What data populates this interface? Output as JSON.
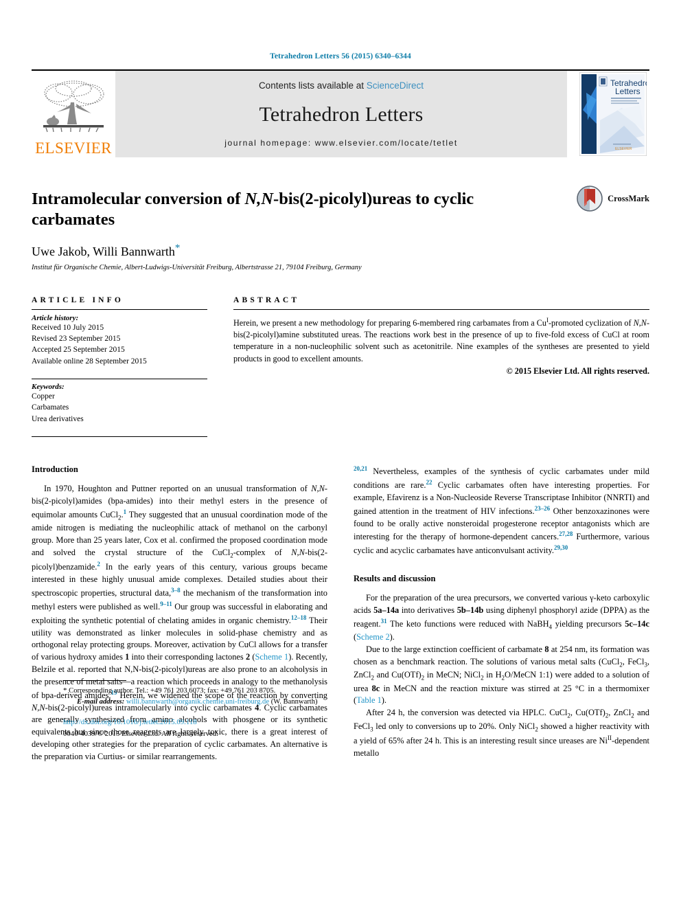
{
  "running_head": "Tetrahedron Letters 56 (2015) 6340–6344",
  "masthead": {
    "contents_prefix": "Contents lists available at ",
    "sciencedirect": "ScienceDirect",
    "journal_name": "Tetrahedron Letters",
    "homepage": "journal homepage: www.elsevier.com/locate/tetlet",
    "publisher_wordmark": "ELSEVIER",
    "cover_title_line1": "Tetrahedron",
    "cover_title_line2": "Letters",
    "colors": {
      "link": "#3c8fbf",
      "elsevier_orange": "#f07f09",
      "running_head": "#0c7ca8",
      "masthead_bg": "#e4e4e4"
    }
  },
  "title": {
    "part1": "Intramolecular conversion of ",
    "italic": "N,N",
    "part2": "-bis(2-picolyl)ureas to cyclic carbamates"
  },
  "authors": "Uwe Jakob, Willi Bannwarth",
  "corresponding_star": "*",
  "affiliation": "Institut für Organische Chemie, Albert-Ludwigs-Universität Freiburg, Albertstrasse 21, 79104 Freiburg, Germany",
  "crossmark_label": "CrossMark",
  "article_info": {
    "heading": "ARTICLE INFO",
    "history_label": "Article history:",
    "history": [
      "Received 10 July 2015",
      "Revised 23 September 2015",
      "Accepted 25 September 2015",
      "Available online 28 September 2015"
    ],
    "keywords_label": "Keywords:",
    "keywords": [
      "Copper",
      "Carbamates",
      "Urea derivatives"
    ]
  },
  "abstract": {
    "heading": "ABSTRACT",
    "p1_a": "Herein, we present a new methodology for preparing 6-membered ring carbamates from a Cu",
    "p1_sup": "I",
    "p1_b": "-promoted cyclization of ",
    "p1_it": "N,N",
    "p1_c": "-bis(2-picolyl)amine substituted ureas. The reactions work best in the presence of up to five-fold excess of CuCl at room temperature in a non-nucleophilic solvent such as acetonitrile. Nine examples of the syntheses are presented to yield products in good to excellent amounts.",
    "copyright": "© 2015 Elsevier Ltd. All rights reserved."
  },
  "body": {
    "introduction_heading": "Introduction",
    "results_heading": "Results and discussion",
    "intro_p1": {
      "s1": "In 1970, Houghton and Puttner reported on an unusual transformation of ",
      "it1": "N,N",
      "s2": "-bis(2-picolyl)amides (bpa-amides) into their methyl esters in the presence of equimolar amounts CuCl",
      "sub1": "2",
      "s3": ".",
      "ref1": "1",
      "s4": " They suggested that an unusual coordination mode of the amide nitrogen is mediating the nucleophilic attack of methanol on the carbonyl group. More than 25 years later, Cox et al. confirmed the proposed coordination mode and solved the crystal structure of the CuCl",
      "sub2": "2",
      "s5": "-complex of ",
      "it2": "N,N",
      "s6": "-bis(2-picolyl)benzamide.",
      "ref2": "2",
      "s7": " In the early years of this century, various groups became interested in these highly unusual amide complexes. Detailed studies about their spectroscopic properties, structural data,",
      "ref3": "3–8",
      "s8": " the mechanism of the transformation into methyl esters were published as well.",
      "ref4": "9–11",
      "s9": " Our group was successful in elaborating and exploiting the synthetic potential of chelating amides in organic chemistry.",
      "ref5": "12–18",
      "s10": " Their utility was demonstrated as linker molecules in solid-phase chemistry and as orthogonal relay protecting groups. Moreover, activation by CuCl allows for a transfer of various hydroxy amides ",
      "b1": "1",
      "s11": " into their corresponding lactones ",
      "b2": "2",
      "s12": " (",
      "link1": "Scheme 1",
      "s13": "). Recently, Belzile et al. reported that N,N-bis(2-picolyl)ureas are also prone to an alcoholysis in the presence of metal salts—a reaction which proceeds in analogy to the methanolysis of bpa-derived amides.",
      "ref6": "19",
      "s14": " Herein, we widened the scope of the reaction by converting ",
      "it3": "N,N",
      "s15": "-bis(2-picolyl)ureas intramolecularly into cyclic carbamates ",
      "b3": "4",
      "s16": ". Cyclic carbamates are generally synthesized from amino alcohols with phosgene or its synthetic equivalents but since those reagents are largely toxic, there is a great interest of developing other strategies for the preparation of cyclic carbamates. An alternative is the preparation via Curtius- or similar rearrangements.",
      "ref7": "20,21",
      "s17": " Nevertheless, examples of the synthesis of cyclic carbamates under mild conditions are rare.",
      "ref8": "22",
      "s18": " Cyclic carbamates often have interesting properties. For example, Efavirenz is a Non-Nucleoside Reverse Transcriptase Inhibitor (NNRTI) and gained attention in the treatment of HIV infections.",
      "ref9": "23–26",
      "s19": " Other benzoxazinones were found to be orally active nonsteroidal progesterone receptor antagonists which are interesting for the therapy of hormone-dependent cancers.",
      "ref10": "27,28",
      "s20": " Furthermore, various cyclic and acyclic carbamates have anticonvulsant activity.",
      "ref11": "29,30"
    },
    "results_p1": {
      "s1": "For the preparation of the urea precursors, we converted various γ-keto carboxylic acids ",
      "b1": "5a–14a",
      "s2": " into derivatives ",
      "b2": "5b–14b",
      "s3": " using diphenyl phosphoryl azide (DPPA) as the reagent.",
      "ref1": "31",
      "s4": " The keto functions were reduced with NaBH",
      "sub1": "4",
      "s5": " yielding precursors ",
      "b3": "5c–14c",
      "s6": " (",
      "link1": "Scheme 2",
      "s7": ")."
    },
    "results_p2": {
      "s1": "Due to the large extinction coefficient of carbamate ",
      "b1": "8",
      "s2": " at 254 nm, its formation was chosen as a benchmark reaction. The solutions of various metal salts (CuCl",
      "sub1": "2",
      "s3": ", FeCl",
      "sub2": "3",
      "s4": ", ZnCl",
      "sub3": "2",
      "s5": " and Cu(OTf)",
      "sub4": "2",
      "s6": " in MeCN; NiCl",
      "sub5": "2",
      "s7": " in H",
      "sub6": "2",
      "s8": "O/MeCN 1:1) were added to a solution of urea ",
      "b2": "8c",
      "s9": " in MeCN and the reaction mixture was stirred at 25 °C in a thermomixer (",
      "link1": "Table 1",
      "s10": ")."
    },
    "results_p3": {
      "s1": "After 24 h, the conversion was detected via HPLC. CuCl",
      "sub1": "2",
      "s2": ", Cu(OTf)",
      "sub2": "2",
      "s3": ", ZnCl",
      "sub3": "2",
      "s4": " and FeCl",
      "sub4": "3",
      "s5": " led only to conversions up to 20%. Only NiCl",
      "sub5": "2",
      "s6": " showed a higher reactivity with a yield of 65% after 24 h. This is an interesting result since ureases are Ni",
      "sup1": "II",
      "s7": "-dependent metallo"
    }
  },
  "footnotes": {
    "star": "*",
    "corresponding": "Corresponding author. Tel.: +49 761 203 6073; fax: +49 761 203 8705.",
    "email_label": "E-mail address:",
    "email": "willi.bannwarth@organik.chemie.uni-freiburg.de",
    "email_suffix": "(W. Bannwarth)",
    "doi": "http://dx.doi.org/10.1016/j.tetlet.2015.09.118",
    "issn_line": "0040-4039/© 2015 Elsevier Ltd. All rights reserved."
  }
}
